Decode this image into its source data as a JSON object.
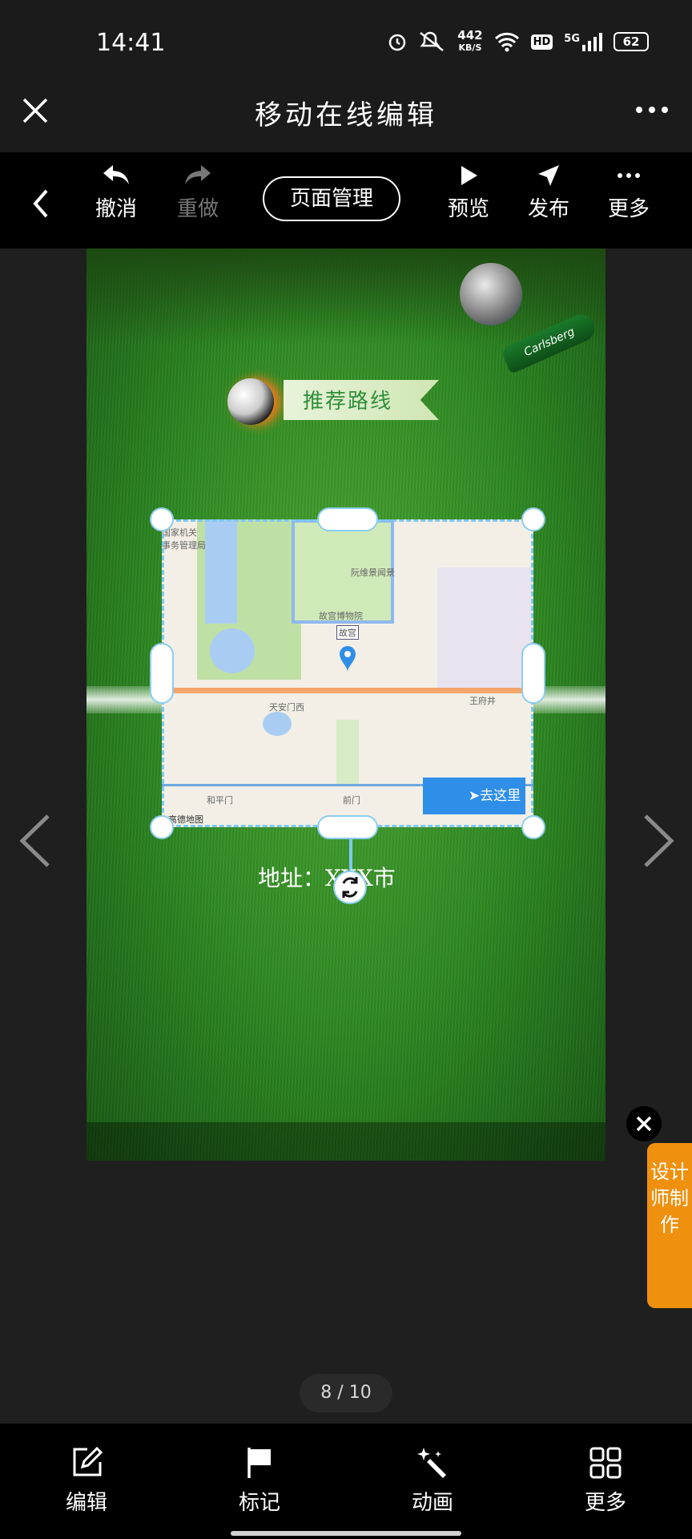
{
  "status_bar": {
    "time": "14:41",
    "net_speed_value": "442",
    "net_speed_unit": "KB/S",
    "hd": "HD",
    "network": "5G",
    "battery": "62"
  },
  "header": {
    "title": "移动在线编辑"
  },
  "toolbar": {
    "undo": "撤消",
    "redo": "重做",
    "page_management": "页面管理",
    "preview": "预览",
    "publish": "发布",
    "more": "更多"
  },
  "canvas": {
    "banner": "推荐路线",
    "bottle_label": "Carlsberg",
    "address": "地址：XXX市",
    "map": {
      "go_button": "去这里",
      "provider": "高德地图",
      "labels": [
        "国家机关",
        "事务管理局",
        "故宫博物院",
        "故宫",
        "天安门西",
        "王府井",
        "和平门",
        "前门",
        "阮维景闻景"
      ]
    }
  },
  "side": {
    "designer_badge": "设计师制作"
  },
  "pager": {
    "text": "8 / 10"
  },
  "bottom_nav": {
    "edit": "编辑",
    "mark": "标记",
    "animation": "动画",
    "more": "更多"
  }
}
